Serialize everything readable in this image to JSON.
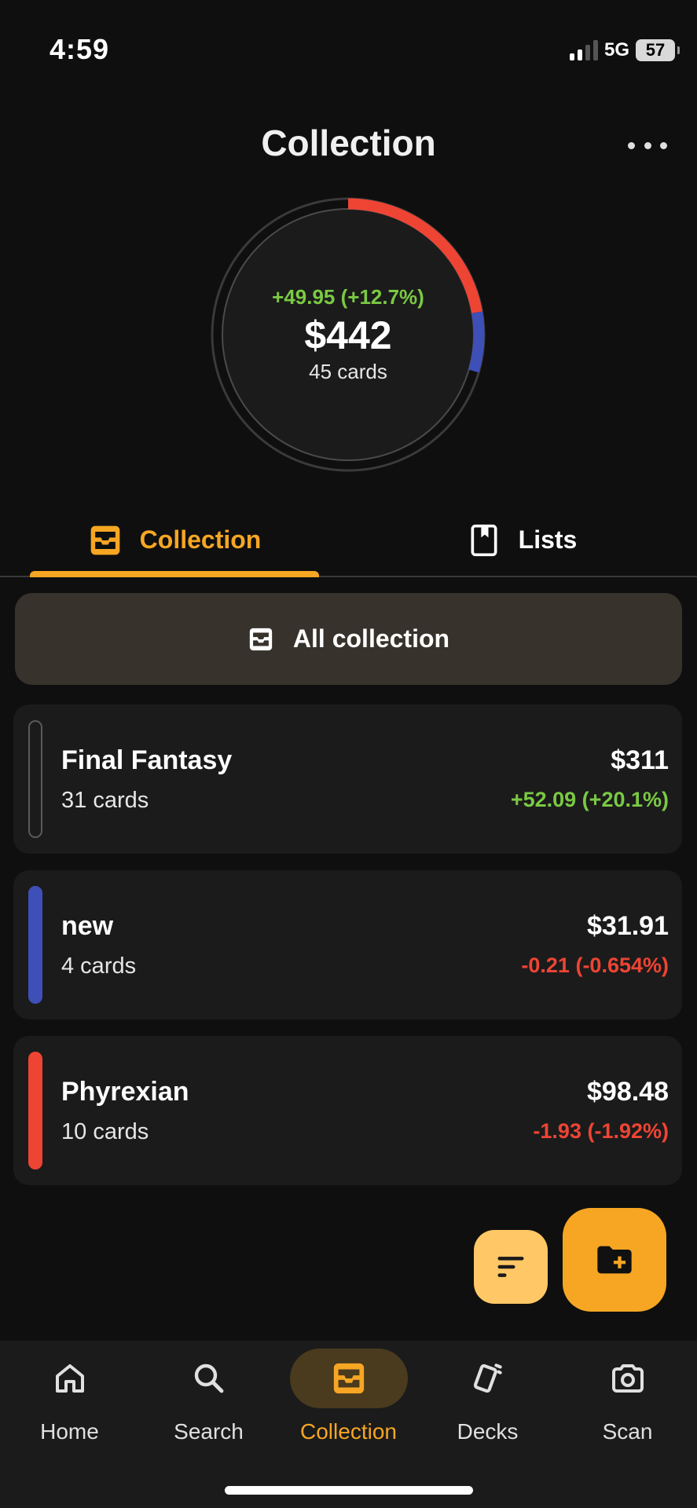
{
  "status": {
    "time": "4:59",
    "network": "5G",
    "battery": "57"
  },
  "header": {
    "title": "Collection"
  },
  "summary": {
    "change": "+49.95 (+12.7%)",
    "value": "$442",
    "count": "45 cards"
  },
  "ring": {
    "total_value": 442,
    "segments": [
      {
        "value": 98.48,
        "color": "#ee4434"
      },
      {
        "value": 31.91,
        "color": "#3f4fb8"
      }
    ]
  },
  "tabs": {
    "collection": "Collection",
    "lists": "Lists"
  },
  "all_collection": {
    "label": "All collection"
  },
  "lists": [
    {
      "name": "Final Fantasy",
      "count": "31 cards",
      "value": "$311",
      "change": "+52.09 (+20.1%)",
      "trend": "up",
      "color": "#1b1b1b"
    },
    {
      "name": "new",
      "count": "4 cards",
      "value": "$31.91",
      "change": "-0.21 (-0.654%)",
      "trend": "down",
      "color": "#3f4fb8"
    },
    {
      "name": "Phyrexian",
      "count": "10 cards",
      "value": "$98.48",
      "change": "-1.93 (-1.92%)",
      "trend": "down",
      "color": "#ee4434"
    }
  ],
  "nav": {
    "home": "Home",
    "search": "Search",
    "collection": "Collection",
    "decks": "Decks",
    "scan": "Scan"
  },
  "colors": {
    "accent": "#f6a623",
    "positive": "#7ac943",
    "negative": "#ee4434"
  }
}
